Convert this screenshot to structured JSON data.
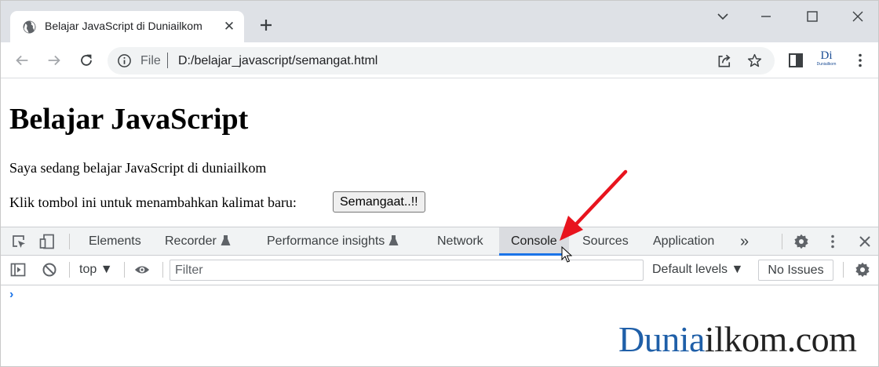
{
  "browser": {
    "tab": {
      "title": "Belajar JavaScript di Duniailkom",
      "close_glyph": "✕"
    },
    "new_tab_label": "+",
    "omnibox": {
      "scheme_label": "File",
      "url": "D:/belajar_javascript/semangat.html"
    },
    "profile": {
      "label": "Di",
      "sub": "Duniailkom"
    }
  },
  "page": {
    "heading": "Belajar JavaScript",
    "paragraph": "Saya sedang belajar JavaScript di duniailkom",
    "prompt_text": "Klik tombol ini untuk menambahkan kalimat baru:",
    "button_label": "Semangaat..!!"
  },
  "devtools": {
    "tabs": [
      {
        "label": "Elements"
      },
      {
        "label": "Recorder"
      },
      {
        "label": "Performance insights"
      },
      {
        "label": "Network"
      },
      {
        "label": "Console",
        "active": true
      },
      {
        "label": "Sources"
      },
      {
        "label": "Application"
      }
    ],
    "more_tabs_glyph": "»",
    "console": {
      "context": "top",
      "filter_placeholder": "Filter",
      "levels": "Default levels",
      "issues": "No Issues",
      "prompt": "›"
    }
  },
  "watermark": {
    "part1": "Dunia",
    "part2": "ilkom.com"
  },
  "colors": {
    "accent": "#1a73e8",
    "annotation_arrow": "#e8141e",
    "brand": "#1f5fa8"
  }
}
